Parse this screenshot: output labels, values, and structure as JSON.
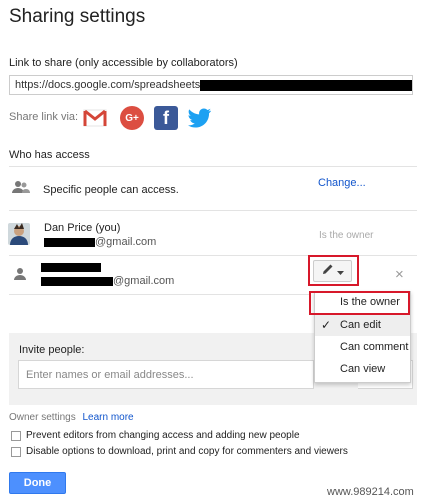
{
  "dialog": {
    "title": "Sharing settings",
    "link_label": "Link to share (only accessible by collaborators)",
    "link_url": "https://docs.google.com/spreadsheets",
    "share_via_label": "Share link via:",
    "social_icons": [
      "gmail-icon",
      "google-plus-icon",
      "facebook-icon",
      "twitter-icon"
    ],
    "gplus_text": "G+",
    "fb_text": "f"
  },
  "access": {
    "heading": "Who has access",
    "specific_text": "Specific people can access.",
    "change_link": "Change...",
    "people": [
      {
        "name": "Dan Price (you)",
        "email_suffix": "@gmail.com",
        "role": "Is the owner"
      },
      {
        "name": "",
        "email_suffix": "@gmail.com",
        "role": "Can edit"
      }
    ],
    "remove_symbol": "×"
  },
  "role_menu": {
    "items": [
      {
        "label": "Is the owner",
        "highlighted": true
      },
      {
        "label": "Can edit",
        "selected": true,
        "check": "✓"
      },
      {
        "label": "Can comment"
      },
      {
        "label": "Can view"
      }
    ]
  },
  "invite": {
    "label": "Invite people:",
    "placeholder": "Enter names or email addresses..."
  },
  "owner_settings": {
    "label": "Owner settings",
    "learn_more": "Learn more",
    "options": [
      {
        "label": "Prevent editors from changing access and adding new people",
        "checked": false
      },
      {
        "label": "Disable options to download, print and copy for commenters and viewers",
        "checked": false
      }
    ]
  },
  "footer": {
    "done_label": "Done",
    "watermark": "www.989214.com"
  },
  "colors": {
    "accent_blue": "#4d90fe",
    "link_blue": "#1155cc",
    "highlight_red": "#d7182a",
    "gmail_red": "#d44638",
    "facebook_blue": "#3b5998",
    "twitter_blue": "#1da1f2"
  }
}
